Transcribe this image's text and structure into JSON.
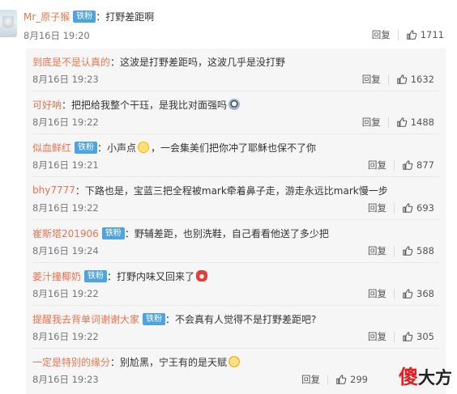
{
  "main_comment": {
    "username": "Mr_原子猴",
    "badge": "铁粉",
    "text": "：打野差距啊",
    "time": "8月16日 19:20",
    "reply_label": "回复",
    "likes": "1711"
  },
  "replies": [
    {
      "username": "到底是不是认真的",
      "badge": "",
      "text": "：这波是打野差距吗，这波几乎是没打野",
      "time": "8月16日 19:23",
      "reply_label": "回复",
      "likes": "1632",
      "emoji": ""
    },
    {
      "username": "可好呐",
      "badge": "",
      "text": "：把把给我整个干珏，是我比对面强吗",
      "time": "8月16日 19:22",
      "reply_label": "回复",
      "likes": "1488",
      "emoji": "scared-emoji"
    },
    {
      "username": "似血鲜红",
      "badge": "铁粉",
      "text": "：小声点",
      "text2": "，一会集美们把你冲了耶稣也保不了你",
      "time": "8月16日 19:21",
      "reply_label": "回复",
      "likes": "877",
      "emoji": "shy-emoji"
    },
    {
      "username": "bhy7777",
      "badge": "",
      "text": "：下路也是，宝蓝三把全程被mark牵着鼻子走，游走永远比mark慢一步",
      "time": "8月16日 19:22",
      "reply_label": "回复",
      "likes": "693",
      "emoji": ""
    },
    {
      "username": "崔斯塔201906",
      "badge": "铁粉",
      "text": "：野辅差距，也别洗鞋，自己看看他送了多少把",
      "time": "8月16日 19:24",
      "reply_label": "回复",
      "likes": "588",
      "emoji": ""
    },
    {
      "username": "姜汁撞椰奶",
      "badge": "铁粉",
      "text": "：打野内味又回来了",
      "time": "8月16日 19:22",
      "reply_label": "回复",
      "likes": "368",
      "emoji": "angry-emoji"
    },
    {
      "username": "提醒我去背单词谢谢大家",
      "badge": "铁粉",
      "text": "：不会真有人觉得不是打野差距吧?",
      "time": "8月16日 19:22",
      "reply_label": "回复",
      "likes": "305",
      "emoji": ""
    },
    {
      "username": "一定是特别的缘分",
      "badge": "",
      "text": "：别尬黑，宁王有的是天赋",
      "time": "8月16日 19:23",
      "reply_label": "回复",
      "likes": "299",
      "emoji": "thinking-emoji"
    }
  ],
  "watermark": {
    "part1": "傻",
    "part2": "大方"
  },
  "colors": {
    "username": "#eb7350",
    "badge": "#4fa3df",
    "panel_bg": "#f6f6f6"
  }
}
